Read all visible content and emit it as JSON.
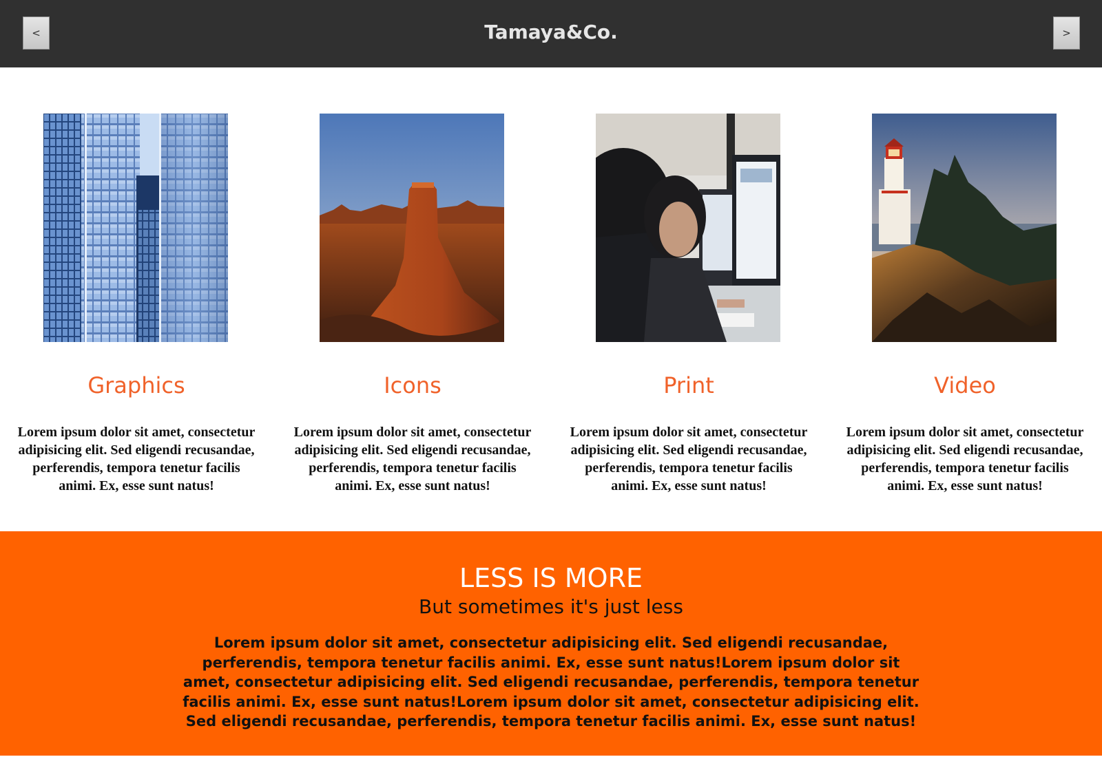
{
  "header": {
    "brand": "Tamaya&Co.",
    "prev_label": "<",
    "next_label": ">"
  },
  "services": [
    {
      "title": "Graphics",
      "image": "glass-skyscrapers-photo",
      "text": "Lorem ipsum dolor sit amet, consectetur adipisicing elit. Sed eligendi recusandae, perferendis, tempora tenetur facilis animi. Ex, esse sunt natus!"
    },
    {
      "title": "Icons",
      "image": "desert-butte-photo",
      "text": "Lorem ipsum dolor sit amet, consectetur adipisicing elit. Sed eligendi recusandae, perferendis, tempora tenetur facilis animi. Ex, esse sunt natus!"
    },
    {
      "title": "Print",
      "image": "office-workers-computers-photo",
      "text": "Lorem ipsum dolor sit amet, consectetur adipisicing elit. Sed eligendi recusandae, perferendis, tempora tenetur facilis animi. Ex, esse sunt natus!"
    },
    {
      "title": "Video",
      "image": "coastal-lighthouse-photo",
      "text": "Lorem ipsum dolor sit amet, consectetur adipisicing elit. Sed eligendi recusandae, perferendis, tempora tenetur facilis animi. Ex, esse sunt natus!"
    }
  ],
  "banner": {
    "heading": "LESS IS MORE",
    "subheading": "But sometimes it's just less",
    "body": "Lorem ipsum dolor sit amet, consectetur adipisicing elit. Sed eligendi recusandae, perferendis, tempora tenetur facilis animi. Ex, esse sunt natus!Lorem ipsum dolor sit amet, consectetur adipisicing elit. Sed eligendi recusandae, perferendis, tempora tenetur facilis animi. Ex, esse sunt natus!Lorem ipsum dolor sit amet, consectetur adipisicing elit. Sed eligendi recusandae, perferendis, tempora tenetur facilis animi. Ex, esse sunt natus!"
  },
  "colors": {
    "header_bg": "#303030",
    "accent_orange": "#ff6200",
    "title_orange": "#f0622a",
    "banner_heading": "#ffffff"
  }
}
